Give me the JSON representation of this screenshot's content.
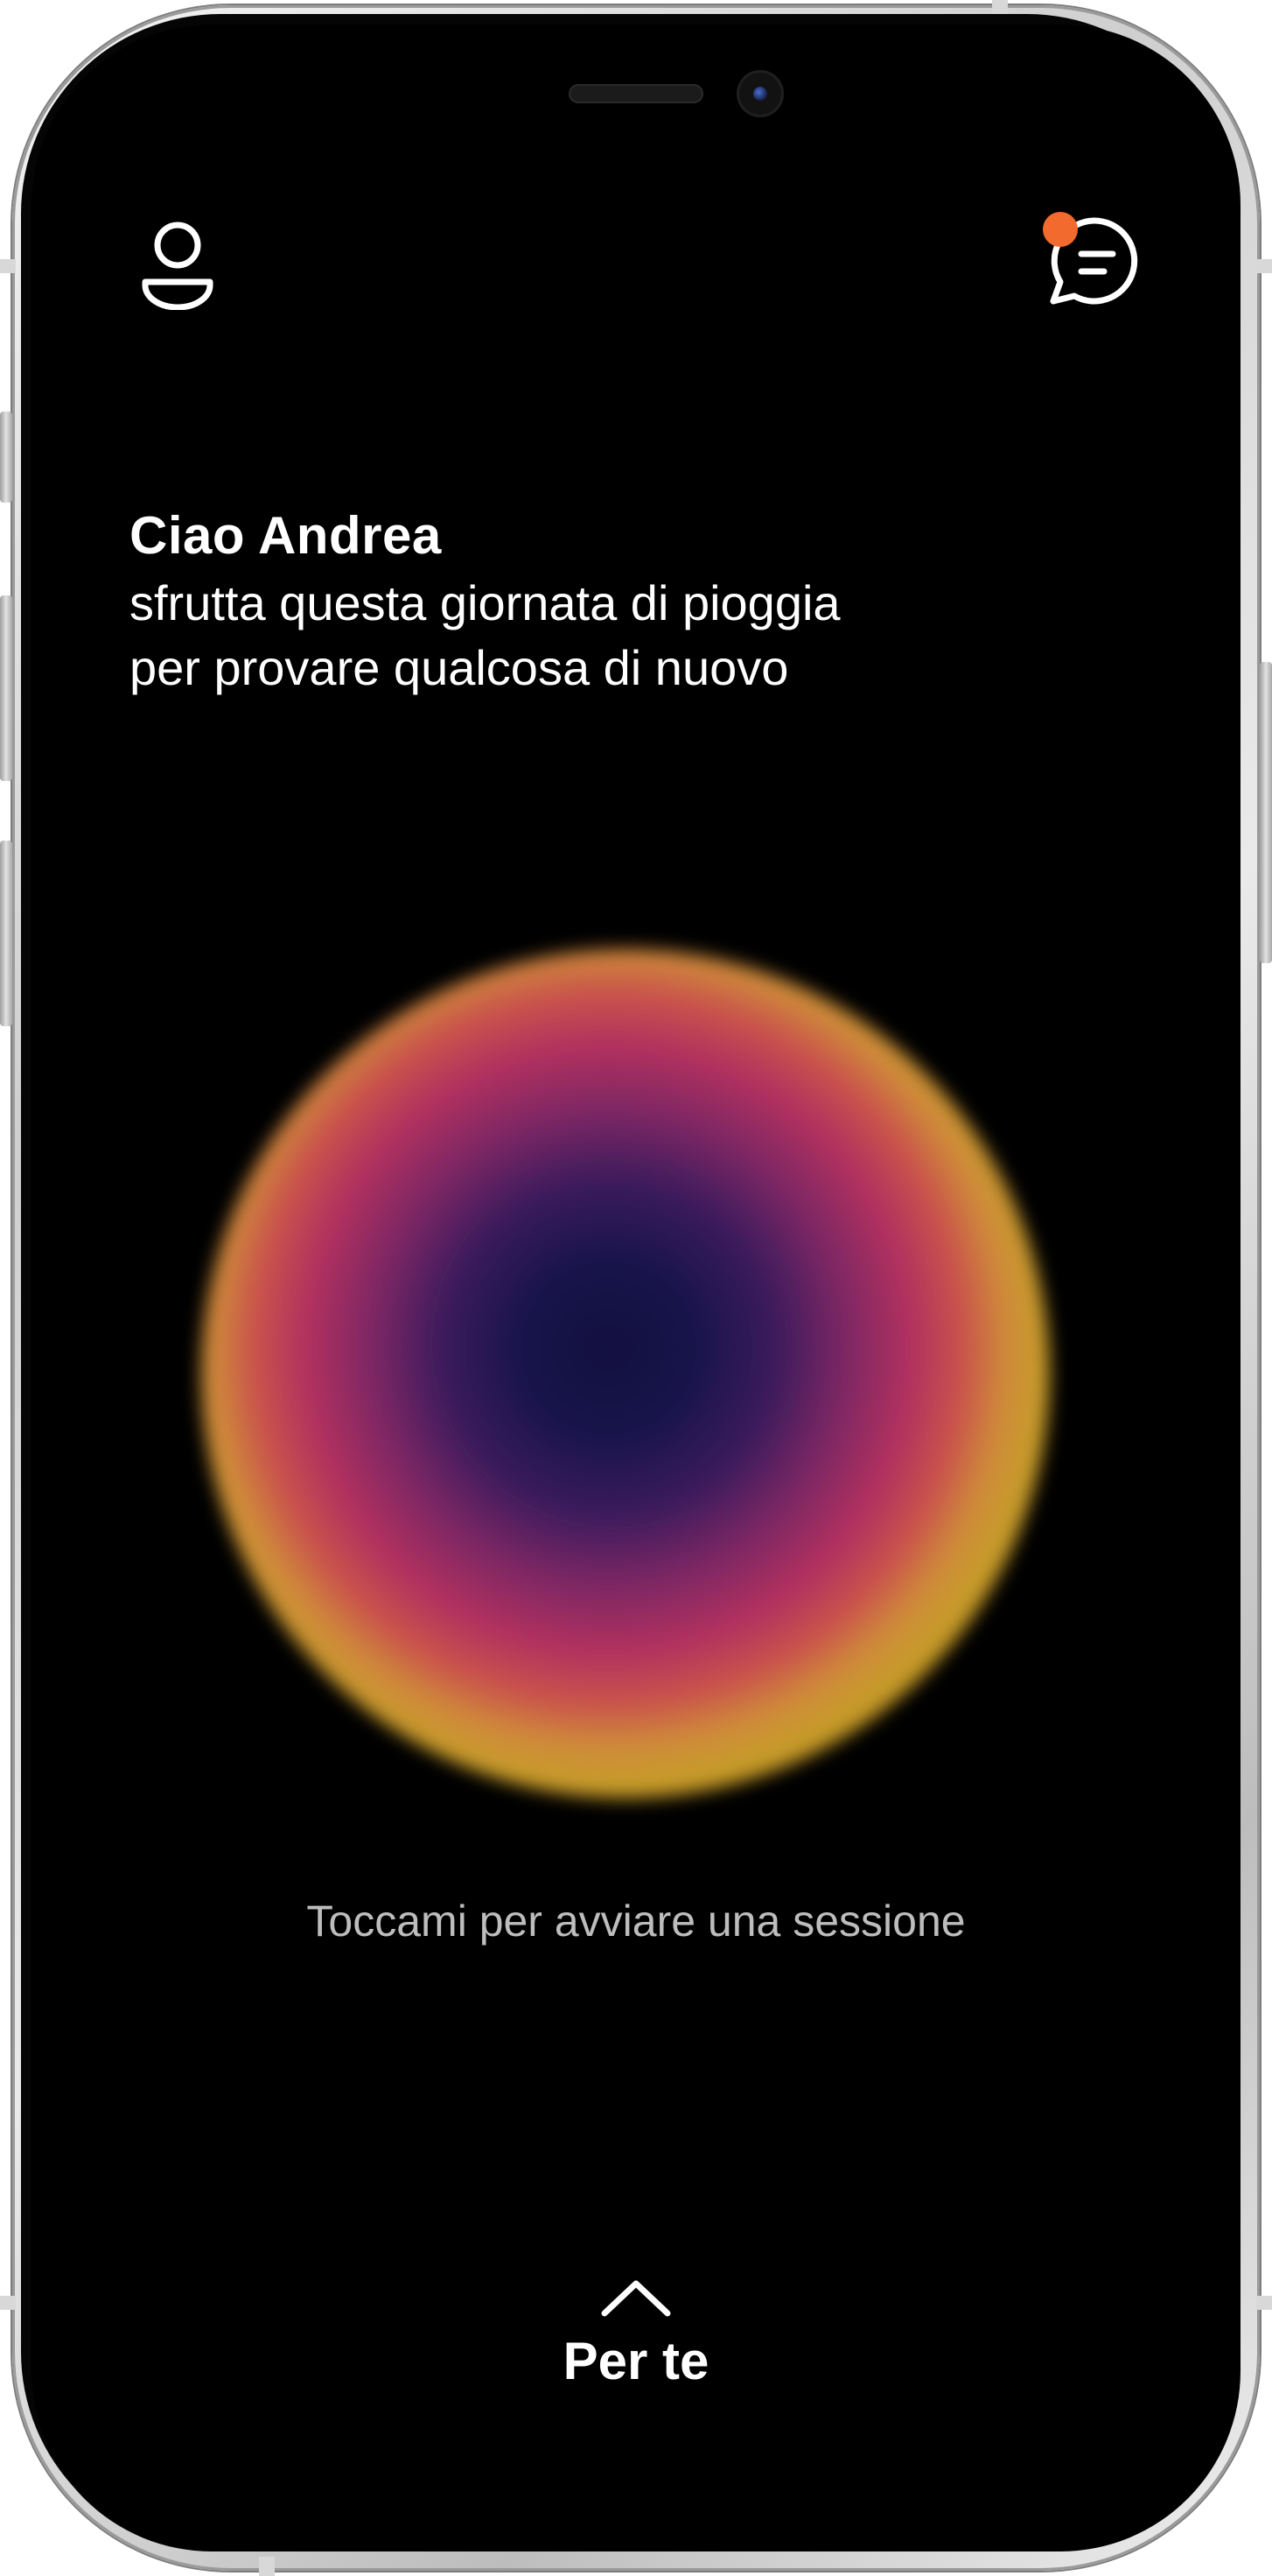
{
  "header": {
    "profile_icon": "user-icon",
    "messages_icon": "chat-icon",
    "notification_color": "#F26A2E"
  },
  "greeting": {
    "name": "Ciao Andrea",
    "line1": "sfrutta questa giornata di pioggia",
    "line2": "per provare qualcosa di nuovo"
  },
  "orb": {
    "hint": "Toccami per avviare una sessione",
    "colors": [
      "#13103F",
      "#B2315F",
      "#C79C2A"
    ]
  },
  "bottom_nav": {
    "chevron_icon": "chevron-up-icon",
    "label": "Per te"
  }
}
